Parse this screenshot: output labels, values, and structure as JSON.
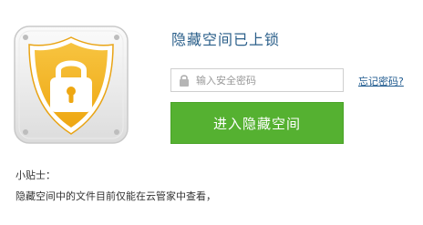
{
  "status": {
    "title": "隐藏空间已上锁"
  },
  "password": {
    "placeholder": "输入安全密码",
    "value": ""
  },
  "forgot": {
    "label": "忘记密码?"
  },
  "enter": {
    "label": "进入隐藏空间"
  },
  "tips": {
    "heading": "小贴士：",
    "text": "隐藏空间中的文件目前仅能在云管家中查看，"
  },
  "icons": {
    "illustration": "shield-lock-icon",
    "field": "lock-icon"
  },
  "colors": {
    "title": "#2b5f8a",
    "button": "#55b131",
    "link": "#1f5a8f",
    "shield": "#f2b01d"
  }
}
